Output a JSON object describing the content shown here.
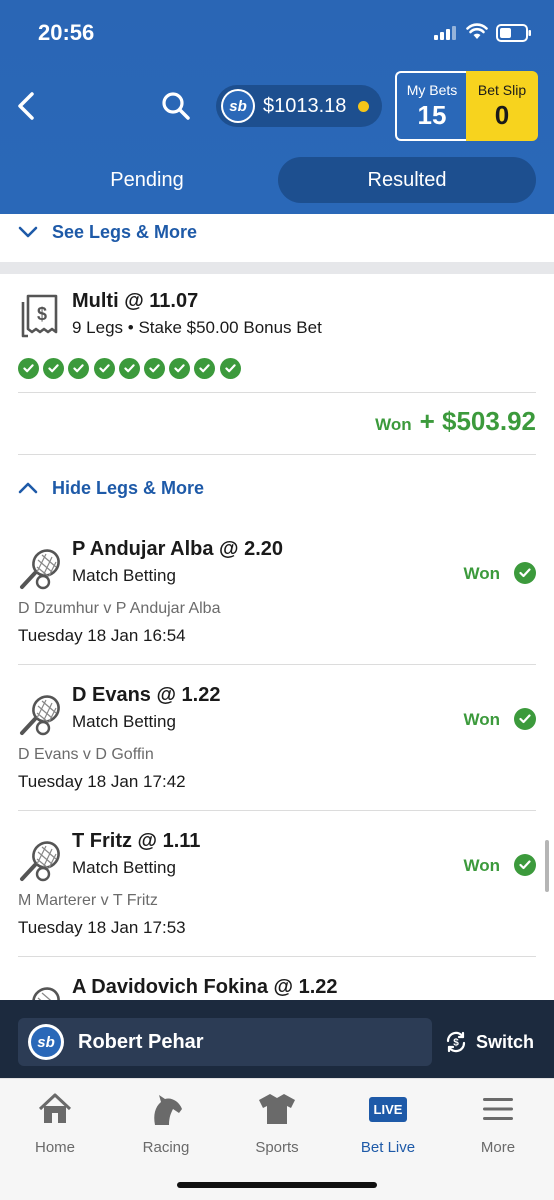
{
  "status_bar": {
    "time": "20:56"
  },
  "header": {
    "balance": "$1013.18",
    "brand_badge": "sb",
    "my_bets_label": "My Bets",
    "my_bets_count": "15",
    "bet_slip_label": "Bet Slip",
    "bet_slip_count": "0"
  },
  "tabs": {
    "pending": "Pending",
    "resulted": "Resulted",
    "active": "Resulted"
  },
  "previous_bet": {
    "see_legs_label": "See Legs & More"
  },
  "bet": {
    "title": "Multi @ 11.07",
    "subtitle": "9 Legs • Stake $50.00 Bonus Bet",
    "legs_won": 9,
    "result_label": "Won",
    "result_amount": "+ $503.92",
    "hide_legs_label": "Hide Legs & More",
    "legs": [
      {
        "title": "P Andujar Alba @ 2.20",
        "market": "Match Betting",
        "result": "Won",
        "match": "D Dzumhur v P Andujar Alba",
        "date": "Tuesday 18 Jan 16:54"
      },
      {
        "title": "D Evans @ 1.22",
        "market": "Match Betting",
        "result": "Won",
        "match": "D Evans v D Goffin",
        "date": "Tuesday 18 Jan 17:42"
      },
      {
        "title": "T Fritz @ 1.11",
        "market": "Match Betting",
        "result": "Won",
        "match": "M Marterer v T Fritz",
        "date": "Tuesday 18 Jan 17:53"
      },
      {
        "title": "A Davidovich Fokina @ 1.22"
      }
    ]
  },
  "account_bar": {
    "name": "Robert Pehar",
    "switch_label": "Switch"
  },
  "bottom_nav": {
    "items": [
      {
        "label": "Home",
        "icon": "home-icon"
      },
      {
        "label": "Racing",
        "icon": "horse-icon"
      },
      {
        "label": "Sports",
        "icon": "jersey-icon"
      },
      {
        "label": "Bet Live",
        "icon": "live-icon",
        "badge": "LIVE"
      },
      {
        "label": "More",
        "icon": "menu-icon"
      }
    ],
    "active": "Bet Live"
  },
  "colors": {
    "brand_blue": "#2a68b8",
    "accent_yellow": "#f7d31e",
    "won_green": "#3c9a3c",
    "link_blue": "#1e5aa8"
  }
}
